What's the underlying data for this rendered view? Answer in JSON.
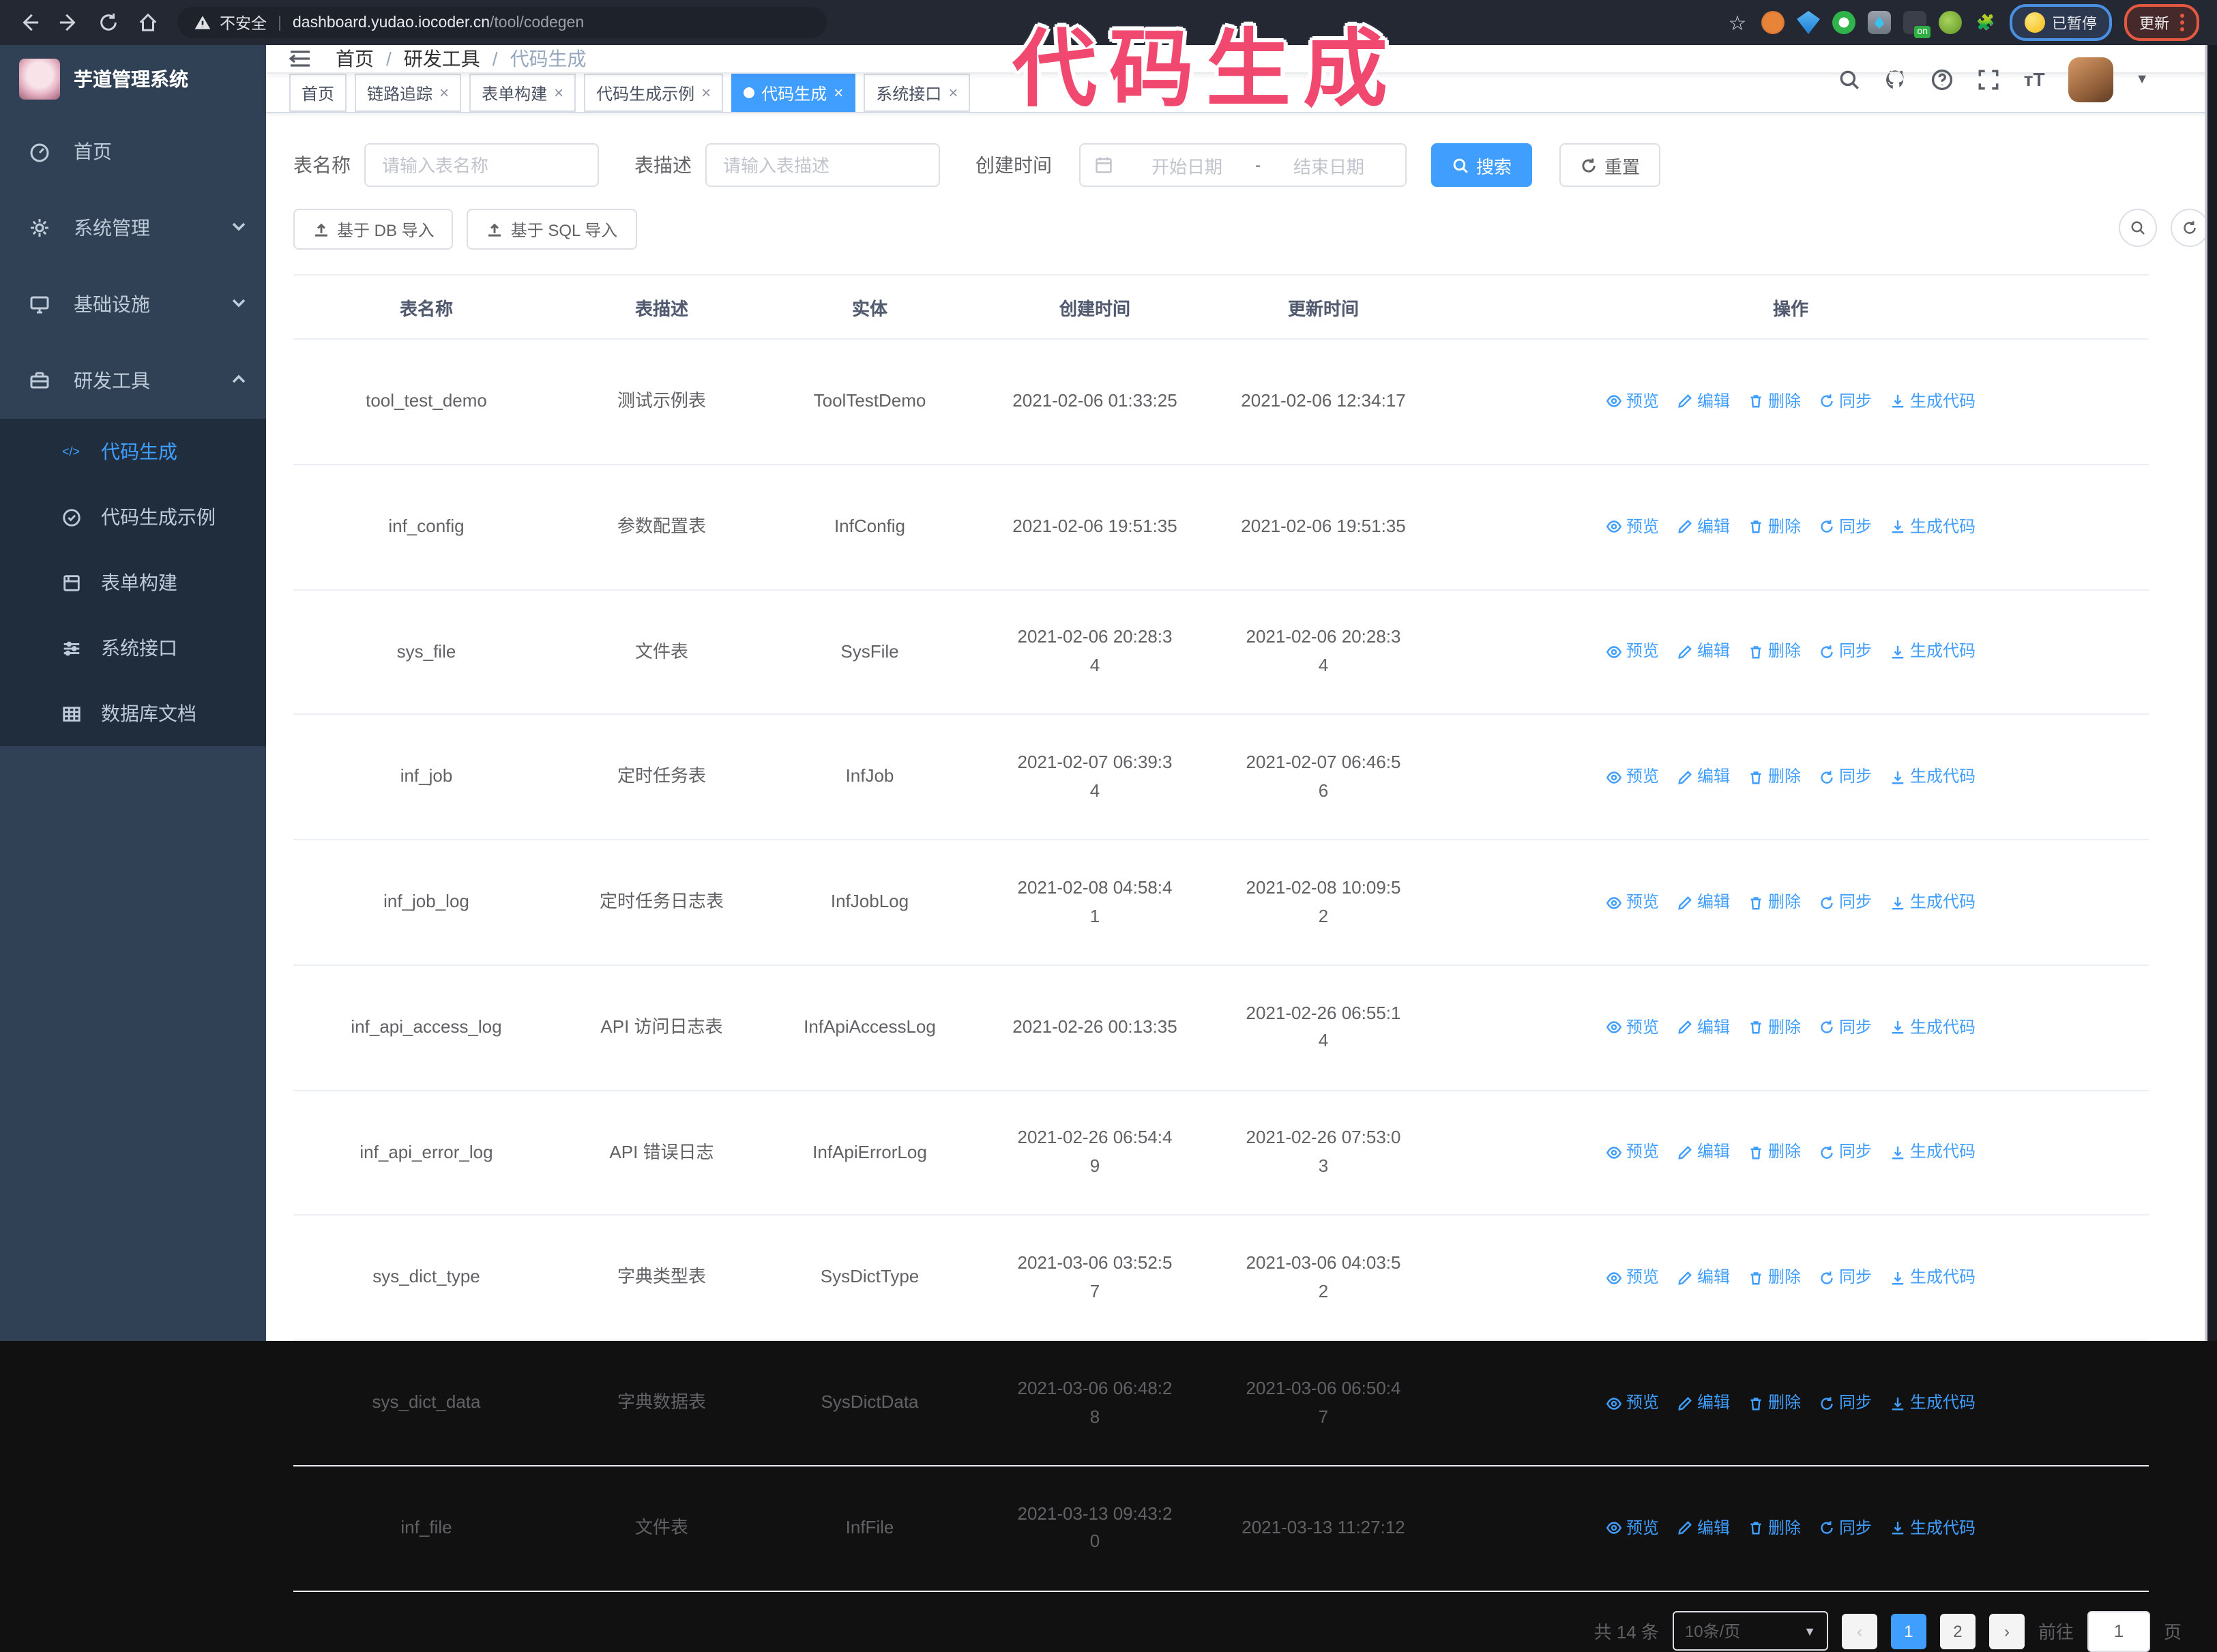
{
  "browser": {
    "insecure_label": "不安全",
    "url_host": "dashboard.yudao.iocoder.cn",
    "url_path": "/tool/codegen",
    "paused_badge": "已暂停",
    "update_button": "更新"
  },
  "annotation": {
    "text": "代码生成"
  },
  "sidebar": {
    "title": "芋道管理系统",
    "items": [
      {
        "label": "首页"
      },
      {
        "label": "系统管理"
      },
      {
        "label": "基础设施"
      },
      {
        "label": "研发工具"
      }
    ],
    "submenu": [
      {
        "label": "代码生成"
      },
      {
        "label": "代码生成示例"
      },
      {
        "label": "表单构建"
      },
      {
        "label": "系统接口"
      },
      {
        "label": "数据库文档"
      }
    ]
  },
  "breadcrumb": [
    "首页",
    "研发工具",
    "代码生成"
  ],
  "tabs": [
    {
      "label": "首页"
    },
    {
      "label": "链路追踪"
    },
    {
      "label": "表单构建"
    },
    {
      "label": "代码生成示例"
    },
    {
      "label": "代码生成"
    },
    {
      "label": "系统接口"
    }
  ],
  "filters": {
    "name_label": "表名称",
    "name_placeholder": "请输入表名称",
    "desc_label": "表描述",
    "desc_placeholder": "请输入表描述",
    "time_label": "创建时间",
    "date_start_placeholder": "开始日期",
    "date_separator": "-",
    "date_end_placeholder": "结束日期",
    "search_button": "搜索",
    "reset_button": "重置"
  },
  "toolbar": {
    "import_db": "基于 DB 导入",
    "import_sql": "基于 SQL 导入"
  },
  "table": {
    "headers": [
      "表名称",
      "表描述",
      "实体",
      "创建时间",
      "更新时间",
      "操作"
    ],
    "actions": [
      {
        "label": "预览"
      },
      {
        "label": "编辑"
      },
      {
        "label": "删除"
      },
      {
        "label": "同步"
      },
      {
        "label": "生成代码"
      }
    ],
    "rows": [
      {
        "name": "tool_test_demo",
        "desc": "测试示例表",
        "entity": "ToolTestDemo",
        "created": "2021-02-06 01:33:25",
        "updated": "2021-02-06 12:34:17"
      },
      {
        "name": "inf_config",
        "desc": "参数配置表",
        "entity": "InfConfig",
        "created": "2021-02-06 19:51:35",
        "updated": "2021-02-06 19:51:35"
      },
      {
        "name": "sys_file",
        "desc": "文件表",
        "entity": "SysFile",
        "created": "2021-02-06 20:28:3\n4",
        "updated": "2021-02-06 20:28:3\n4"
      },
      {
        "name": "inf_job",
        "desc": "定时任务表",
        "entity": "InfJob",
        "created": "2021-02-07 06:39:3\n4",
        "updated": "2021-02-07 06:46:5\n6"
      },
      {
        "name": "inf_job_log",
        "desc": "定时任务日志表",
        "entity": "InfJobLog",
        "created": "2021-02-08 04:58:4\n1",
        "updated": "2021-02-08 10:09:5\n2"
      },
      {
        "name": "inf_api_access_log",
        "desc": "API 访问日志表",
        "entity": "InfApiAccessLog",
        "created": "2021-02-26 00:13:35",
        "updated": "2021-02-26 06:55:1\n4"
      },
      {
        "name": "inf_api_error_log",
        "desc": "API 错误日志",
        "entity": "InfApiErrorLog",
        "created": "2021-02-26 06:54:4\n9",
        "updated": "2021-02-26 07:53:0\n3"
      },
      {
        "name": "sys_dict_type",
        "desc": "字典类型表",
        "entity": "SysDictType",
        "created": "2021-03-06 03:52:5\n7",
        "updated": "2021-03-06 04:03:5\n2"
      },
      {
        "name": "sys_dict_data",
        "desc": "字典数据表",
        "entity": "SysDictData",
        "created": "2021-03-06 06:48:2\n8",
        "updated": "2021-03-06 06:50:4\n7"
      },
      {
        "name": "inf_file",
        "desc": "文件表",
        "entity": "InfFile",
        "created": "2021-03-13 09:43:2\n0",
        "updated": "2021-03-13 11:27:12"
      }
    ]
  },
  "pagination": {
    "total_text": "共 14 条",
    "page_size": "10条/页",
    "page_1": "1",
    "page_2": "2",
    "goto_label": "前往",
    "goto_value": "1",
    "page_unit": "页"
  },
  "colors": {
    "primary": "#409eff",
    "sidebar_bg": "#304156",
    "submenu_bg": "#1f2d3d",
    "annotation_pink": "#f1486f"
  }
}
